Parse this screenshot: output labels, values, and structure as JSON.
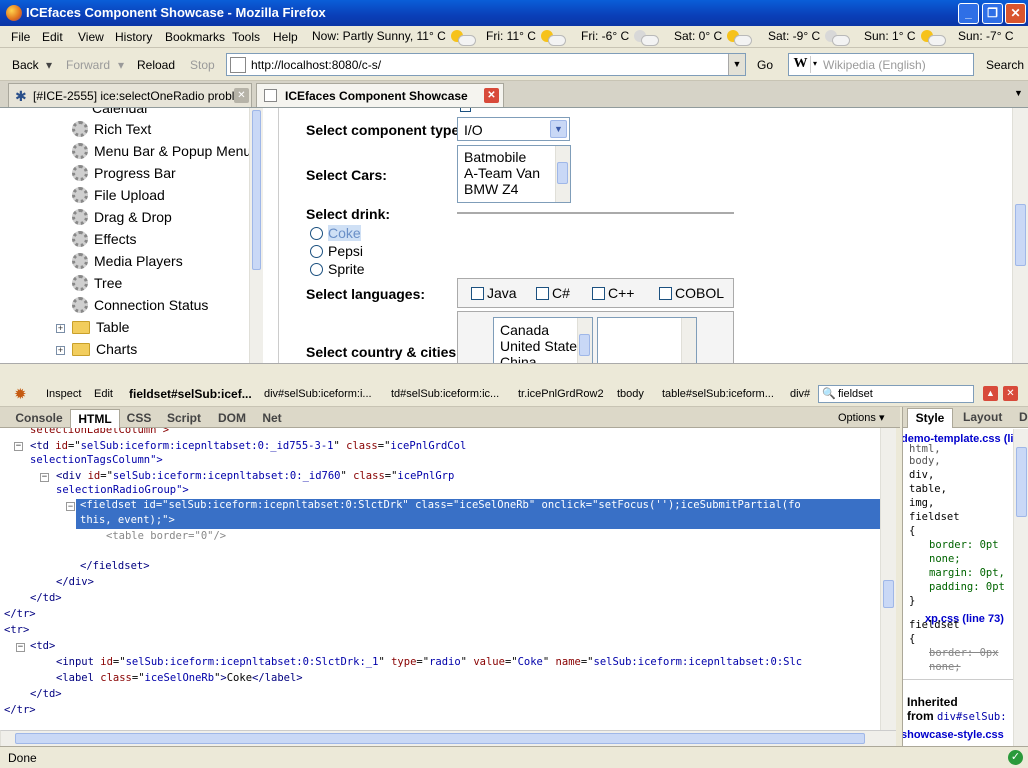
{
  "window": {
    "title": "ICEfaces Component Showcase - Mozilla Firefox"
  },
  "menu": {
    "file": "File",
    "edit": "Edit",
    "view": "View",
    "history": "History",
    "bookmarks": "Bookmarks",
    "tools": "Tools",
    "help": "Help"
  },
  "weather": {
    "now": "Now: Partly Sunny, 11° C",
    "fri1": "Fri: 11° C",
    "fri2": "Fri: -6° C",
    "sat1": "Sat: 0° C",
    "sat2": "Sat: -9° C",
    "sun1": "Sun: 1° C",
    "sun2": "Sun: -7° C"
  },
  "nav": {
    "back": "Back",
    "forward": "Forward",
    "reload": "Reload",
    "stop": "Stop",
    "url": "http://localhost:8080/c-s/",
    "go": "Go",
    "search_placeholder": "Wikipedia (English)",
    "search": "Search"
  },
  "tabs": [
    {
      "label": "[#ICE-2555] ice:selectOneRadio probl..."
    },
    {
      "label": "ICEfaces Component Showcase"
    }
  ],
  "tree": {
    "partial": "Calendar",
    "items": [
      "Rich Text",
      "Menu Bar & Popup Menu",
      "Progress Bar",
      "File Upload",
      "Drag & Drop",
      "Effects",
      "Media Players",
      "Tree",
      "Connection Status"
    ],
    "folders": [
      "Table",
      "Charts"
    ]
  },
  "form": {
    "component_type_label": "Select component type:",
    "component_type_value": "I/O",
    "cars_label": "Select Cars:",
    "cars": [
      "Batmobile",
      "A-Team Van",
      "BMW Z4"
    ],
    "drink_label": "Select drink:",
    "drinks": [
      "Coke",
      "Pepsi",
      "Sprite"
    ],
    "languages_label": "Select languages:",
    "languages": [
      "Java",
      "C#",
      "C++",
      "COBOL"
    ],
    "country_label": "Select country & cities:",
    "countries": [
      "Canada",
      "United States",
      "China"
    ]
  },
  "firebug": {
    "inspect": "Inspect",
    "edit": "Edit",
    "crumbs": [
      "fieldset#selSub:icef...",
      "div#selSub:iceform:i...",
      "td#selSub:iceform:ic...",
      "tr.icePnlGrdRow2",
      "tbody",
      "table#selSub:iceform...",
      "div#"
    ],
    "search": "fieldset",
    "tabs": [
      "Console",
      "HTML",
      "CSS",
      "Script",
      "DOM",
      "Net"
    ],
    "options": "Options ▾",
    "side_tabs": [
      "Style",
      "Layout",
      "D"
    ]
  },
  "code": {
    "l0": "selectionLabelColumn\">",
    "l1_id": "selSub:iceform:icepnltabset:0:_id755-3-1",
    "l1_class": "icePnlGrdCol",
    "l2": "selectionTagsColumn\">",
    "l3_id": "selSub:iceform:icepnltabset:0:_id760",
    "l3_class": "icePnlGrp",
    "l4": "selectionRadioGroup\">",
    "l5_id": "selSub:iceform:icepnltabset:0:SlctDrk",
    "l5_class": "iceSelOneRb",
    "l5_onclick": "setFocus('');iceSubmitPartial(fo",
    "l6": "this, event);\">",
    "l7": "<table border=\"0\"/>",
    "l8": "</fieldset>",
    "l9": "</div>",
    "l10": "</td>",
    "l11": "</tr>",
    "l12": "<tr>",
    "l13": "<td>",
    "l14_id": "selSub:iceform:icepnltabset:0:SlctDrk:_1",
    "l14_type": "radio",
    "l14_value": "Coke",
    "l14_name": "selSub:iceform:icepnltabset:0:Slc",
    "l15_class": "iceSelOneRb",
    "l15_text": "Coke",
    "l16": "</td>",
    "l17": "</tr>"
  },
  "style": {
    "src1": "demo-template.css (line 35)",
    "sel1": [
      "html,",
      "body,",
      "div,",
      "table,",
      "img,",
      "fieldset"
    ],
    "p1": "border: 0pt",
    "p1b": "none;",
    "p2": "margin: 0pt,",
    "p3": "padding: 0pt",
    "src2": "xp.css (line 73)",
    "sel2": "fieldset",
    "p4": "border: 0px",
    "p4b": "none;",
    "inherited": "Inherited",
    "inherited_from": "from",
    "inherited_el": "div#selSub:",
    "src3": "showcase-style.css"
  },
  "status": {
    "text": "Done"
  }
}
